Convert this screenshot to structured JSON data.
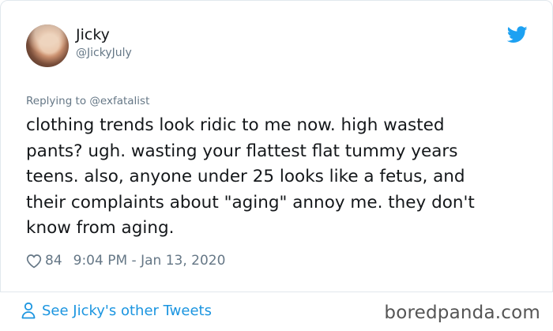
{
  "author": {
    "name": "Jicky",
    "handle": "@JickyJuly"
  },
  "reply": {
    "prefix": "Replying to",
    "mention": "@exfatalist"
  },
  "tweet": {
    "text": "clothing trends look ridic to me now. high wasted\npants? ugh. wasting your flattest flat tummy years\nteens. also, anyone under 25 looks like a fetus, and\ntheir complaints about \"aging\" annoy me. they don't\nknow from aging."
  },
  "meta": {
    "likes": "84",
    "timestamp": "9:04 PM - Jan 13, 2020"
  },
  "footer": {
    "see_more": "See Jicky's other Tweets",
    "brand": "boredpanda.com"
  },
  "colors": {
    "twitter_blue": "#1da1f2",
    "link_blue": "#1b95e0",
    "muted": "#657786"
  },
  "icons": {
    "bird": "twitter-bird-icon",
    "heart": "heart-icon",
    "person": "person-icon"
  }
}
